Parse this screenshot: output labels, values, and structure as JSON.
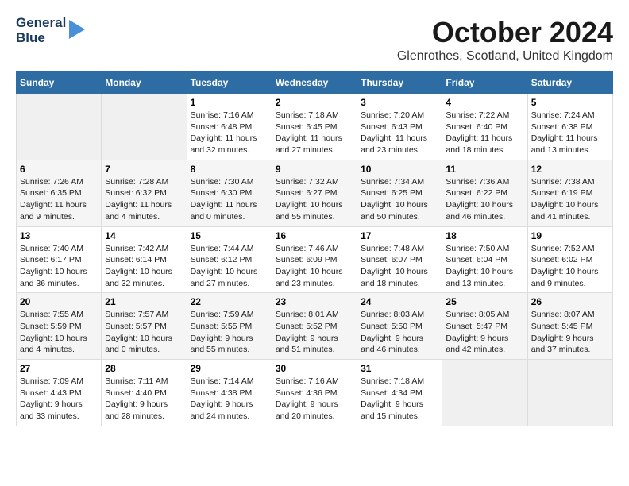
{
  "header": {
    "logo_line1": "General",
    "logo_line2": "Blue",
    "month_title": "October 2024",
    "location": "Glenrothes, Scotland, United Kingdom"
  },
  "weekdays": [
    "Sunday",
    "Monday",
    "Tuesday",
    "Wednesday",
    "Thursday",
    "Friday",
    "Saturday"
  ],
  "weeks": [
    [
      {
        "day": "",
        "info": ""
      },
      {
        "day": "",
        "info": ""
      },
      {
        "day": "1",
        "info": "Sunrise: 7:16 AM\nSunset: 6:48 PM\nDaylight: 11 hours and 32 minutes."
      },
      {
        "day": "2",
        "info": "Sunrise: 7:18 AM\nSunset: 6:45 PM\nDaylight: 11 hours and 27 minutes."
      },
      {
        "day": "3",
        "info": "Sunrise: 7:20 AM\nSunset: 6:43 PM\nDaylight: 11 hours and 23 minutes."
      },
      {
        "day": "4",
        "info": "Sunrise: 7:22 AM\nSunset: 6:40 PM\nDaylight: 11 hours and 18 minutes."
      },
      {
        "day": "5",
        "info": "Sunrise: 7:24 AM\nSunset: 6:38 PM\nDaylight: 11 hours and 13 minutes."
      }
    ],
    [
      {
        "day": "6",
        "info": "Sunrise: 7:26 AM\nSunset: 6:35 PM\nDaylight: 11 hours and 9 minutes."
      },
      {
        "day": "7",
        "info": "Sunrise: 7:28 AM\nSunset: 6:32 PM\nDaylight: 11 hours and 4 minutes."
      },
      {
        "day": "8",
        "info": "Sunrise: 7:30 AM\nSunset: 6:30 PM\nDaylight: 11 hours and 0 minutes."
      },
      {
        "day": "9",
        "info": "Sunrise: 7:32 AM\nSunset: 6:27 PM\nDaylight: 10 hours and 55 minutes."
      },
      {
        "day": "10",
        "info": "Sunrise: 7:34 AM\nSunset: 6:25 PM\nDaylight: 10 hours and 50 minutes."
      },
      {
        "day": "11",
        "info": "Sunrise: 7:36 AM\nSunset: 6:22 PM\nDaylight: 10 hours and 46 minutes."
      },
      {
        "day": "12",
        "info": "Sunrise: 7:38 AM\nSunset: 6:19 PM\nDaylight: 10 hours and 41 minutes."
      }
    ],
    [
      {
        "day": "13",
        "info": "Sunrise: 7:40 AM\nSunset: 6:17 PM\nDaylight: 10 hours and 36 minutes."
      },
      {
        "day": "14",
        "info": "Sunrise: 7:42 AM\nSunset: 6:14 PM\nDaylight: 10 hours and 32 minutes."
      },
      {
        "day": "15",
        "info": "Sunrise: 7:44 AM\nSunset: 6:12 PM\nDaylight: 10 hours and 27 minutes."
      },
      {
        "day": "16",
        "info": "Sunrise: 7:46 AM\nSunset: 6:09 PM\nDaylight: 10 hours and 23 minutes."
      },
      {
        "day": "17",
        "info": "Sunrise: 7:48 AM\nSunset: 6:07 PM\nDaylight: 10 hours and 18 minutes."
      },
      {
        "day": "18",
        "info": "Sunrise: 7:50 AM\nSunset: 6:04 PM\nDaylight: 10 hours and 13 minutes."
      },
      {
        "day": "19",
        "info": "Sunrise: 7:52 AM\nSunset: 6:02 PM\nDaylight: 10 hours and 9 minutes."
      }
    ],
    [
      {
        "day": "20",
        "info": "Sunrise: 7:55 AM\nSunset: 5:59 PM\nDaylight: 10 hours and 4 minutes."
      },
      {
        "day": "21",
        "info": "Sunrise: 7:57 AM\nSunset: 5:57 PM\nDaylight: 10 hours and 0 minutes."
      },
      {
        "day": "22",
        "info": "Sunrise: 7:59 AM\nSunset: 5:55 PM\nDaylight: 9 hours and 55 minutes."
      },
      {
        "day": "23",
        "info": "Sunrise: 8:01 AM\nSunset: 5:52 PM\nDaylight: 9 hours and 51 minutes."
      },
      {
        "day": "24",
        "info": "Sunrise: 8:03 AM\nSunset: 5:50 PM\nDaylight: 9 hours and 46 minutes."
      },
      {
        "day": "25",
        "info": "Sunrise: 8:05 AM\nSunset: 5:47 PM\nDaylight: 9 hours and 42 minutes."
      },
      {
        "day": "26",
        "info": "Sunrise: 8:07 AM\nSunset: 5:45 PM\nDaylight: 9 hours and 37 minutes."
      }
    ],
    [
      {
        "day": "27",
        "info": "Sunrise: 7:09 AM\nSunset: 4:43 PM\nDaylight: 9 hours and 33 minutes."
      },
      {
        "day": "28",
        "info": "Sunrise: 7:11 AM\nSunset: 4:40 PM\nDaylight: 9 hours and 28 minutes."
      },
      {
        "day": "29",
        "info": "Sunrise: 7:14 AM\nSunset: 4:38 PM\nDaylight: 9 hours and 24 minutes."
      },
      {
        "day": "30",
        "info": "Sunrise: 7:16 AM\nSunset: 4:36 PM\nDaylight: 9 hours and 20 minutes."
      },
      {
        "day": "31",
        "info": "Sunrise: 7:18 AM\nSunset: 4:34 PM\nDaylight: 9 hours and 15 minutes."
      },
      {
        "day": "",
        "info": ""
      },
      {
        "day": "",
        "info": ""
      }
    ]
  ]
}
